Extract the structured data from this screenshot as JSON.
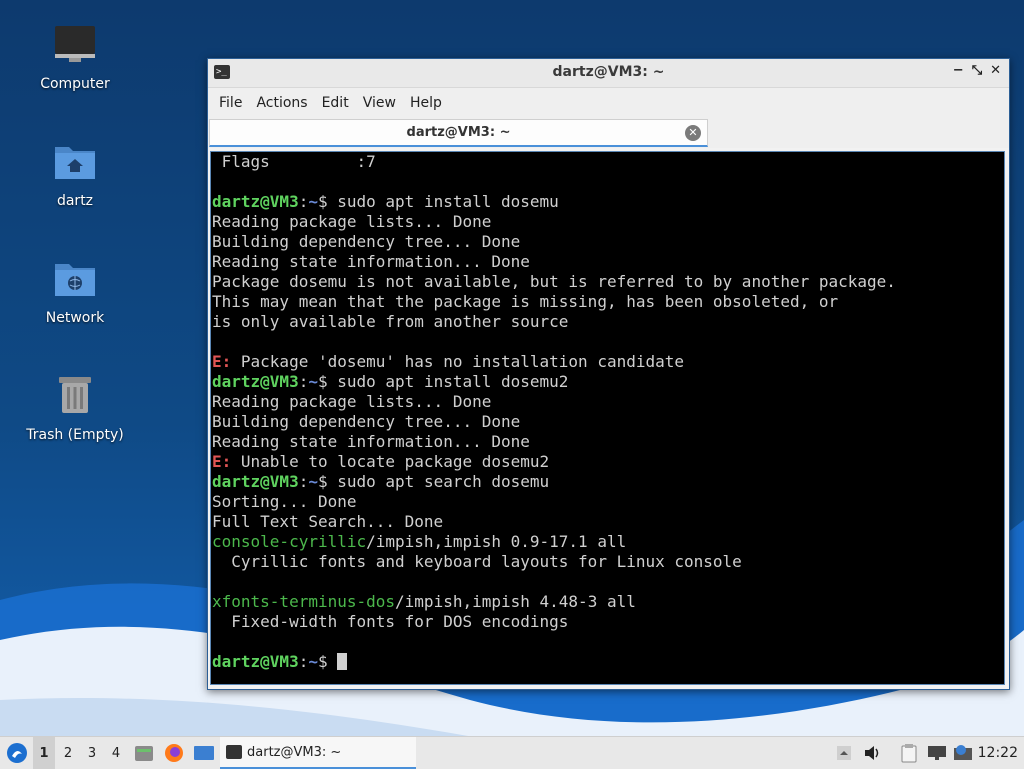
{
  "desktop": {
    "icons": [
      {
        "label": "Computer",
        "icon": "computer-icon"
      },
      {
        "label": "dartz",
        "icon": "home-folder-icon"
      },
      {
        "label": "Network",
        "icon": "network-folder-icon"
      },
      {
        "label": "Trash (Empty)",
        "icon": "trash-icon"
      }
    ]
  },
  "window": {
    "title": "dartz@VM3: ~",
    "controls": [
      "−",
      "⤡",
      "✕"
    ],
    "menu": [
      "File",
      "Actions",
      "Edit",
      "View",
      "Help"
    ],
    "tab": {
      "label": "dartz@VM3: ~",
      "close": "✕"
    }
  },
  "terminal": {
    "prompt_user": "dartz@VM3",
    "prompt_sep": ":",
    "prompt_path": "~",
    "prompt_end": "$ ",
    "lines": [
      {
        "t": "out",
        "text": " Flags         :7"
      },
      {
        "t": "blank"
      },
      {
        "t": "cmd",
        "text": "sudo apt install dosemu"
      },
      {
        "t": "out",
        "text": "Reading package lists... Done"
      },
      {
        "t": "out",
        "text": "Building dependency tree... Done"
      },
      {
        "t": "out",
        "text": "Reading state information... Done"
      },
      {
        "t": "out",
        "text": "Package dosemu is not available, but is referred to by another package."
      },
      {
        "t": "out",
        "text": "This may mean that the package is missing, has been obsoleted, or"
      },
      {
        "t": "out",
        "text": "is only available from another source"
      },
      {
        "t": "blank"
      },
      {
        "t": "err",
        "prefix": "E:",
        "text": " Package 'dosemu' has no installation candidate"
      },
      {
        "t": "cmd",
        "text": "sudo apt install dosemu2"
      },
      {
        "t": "out",
        "text": "Reading package lists... Done"
      },
      {
        "t": "out",
        "text": "Building dependency tree... Done"
      },
      {
        "t": "out",
        "text": "Reading state information... Done"
      },
      {
        "t": "err",
        "prefix": "E:",
        "text": " Unable to locate package dosemu2"
      },
      {
        "t": "cmd",
        "text": "sudo apt search dosemu"
      },
      {
        "t": "out",
        "text": "Sorting... Done"
      },
      {
        "t": "out",
        "text": "Full Text Search... Done"
      },
      {
        "t": "pkg",
        "name": "console-cyrillic",
        "text": "/impish,impish 0.9-17.1 all"
      },
      {
        "t": "out",
        "text": "  Cyrillic fonts and keyboard layouts for Linux console"
      },
      {
        "t": "blank"
      },
      {
        "t": "pkg",
        "name": "xfonts-terminus-dos",
        "text": "/impish,impish 4.48-3 all"
      },
      {
        "t": "out",
        "text": "  Fixed-width fonts for DOS encodings"
      },
      {
        "t": "blank"
      },
      {
        "t": "prompt"
      }
    ]
  },
  "taskbar": {
    "workspaces": [
      "1",
      "2",
      "3",
      "4"
    ],
    "active_workspace": "1",
    "task_label": "dartz@VM3: ~",
    "clock": "12:22"
  },
  "colors": {
    "prompt_user": "#5fd35f",
    "prompt_path": "#6b8bd6",
    "error": "#e05555",
    "package": "#4cb84c",
    "accent": "#4a90d9"
  }
}
